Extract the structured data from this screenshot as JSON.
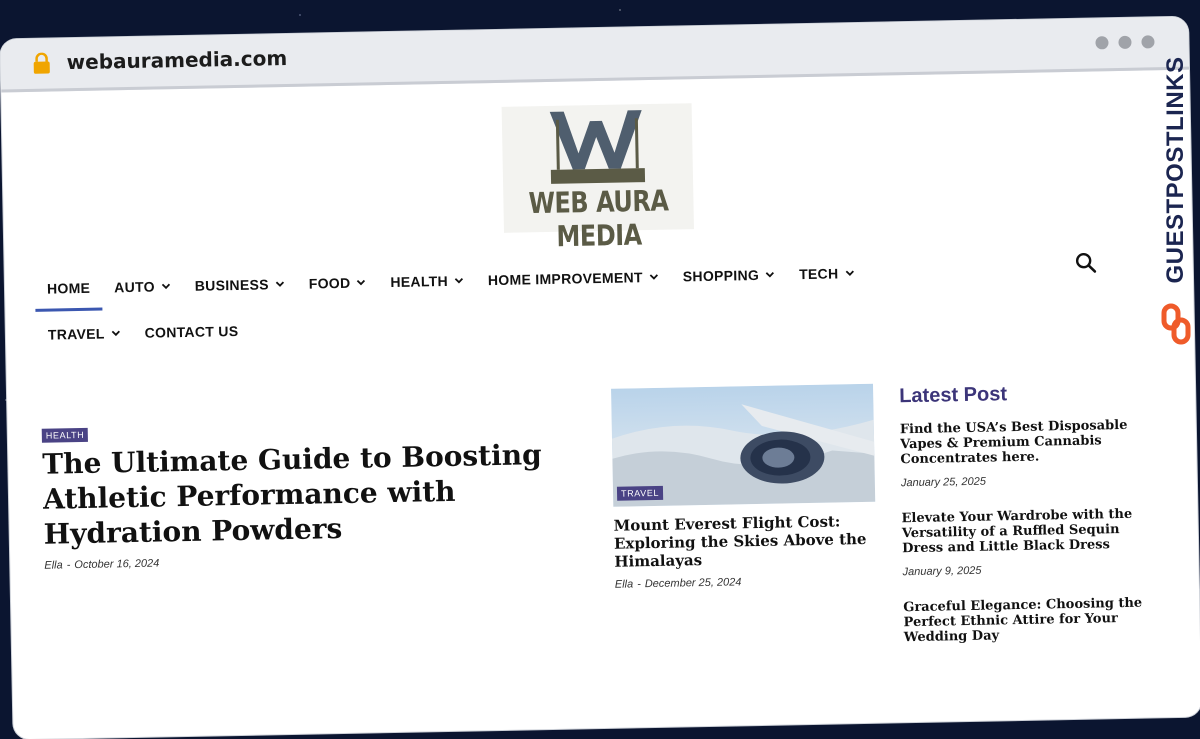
{
  "browser": {
    "url": "webauramedia.com",
    "lock_color": "#f0a500"
  },
  "site": {
    "logo_text": "WEB AURA MEDIA",
    "brand_colors": {
      "logo_blue": "#4f5e6e",
      "logo_olive": "#5b5b46",
      "accent": "#3b57b0"
    }
  },
  "nav": {
    "row1": [
      {
        "label": "HOME",
        "dropdown": false,
        "active": true
      },
      {
        "label": "AUTO",
        "dropdown": true
      },
      {
        "label": "BUSINESS",
        "dropdown": true
      },
      {
        "label": "FOOD",
        "dropdown": true
      },
      {
        "label": "HEALTH",
        "dropdown": true
      },
      {
        "label": "HOME IMPROVEMENT",
        "dropdown": true
      },
      {
        "label": "SHOPPING",
        "dropdown": true
      },
      {
        "label": "TECH",
        "dropdown": true
      }
    ],
    "row2": [
      {
        "label": "TRAVEL",
        "dropdown": true
      },
      {
        "label": "CONTACT US",
        "dropdown": false
      }
    ],
    "search_icon": "search-icon"
  },
  "hero": {
    "category": "HEALTH",
    "title": "The Ultimate Guide to Boosting Athletic Performance with Hydration Powders",
    "author": "Ella",
    "date": "October 16, 2024"
  },
  "card": {
    "category": "TRAVEL",
    "title": "Mount Everest Flight Cost: Exploring the Skies Above the Himalayas",
    "author": "Ella",
    "date": "December 25, 2024"
  },
  "sidebar": {
    "heading": "Latest Post",
    "posts": [
      {
        "title": "Find the USA’s Best Disposable Vapes & Premium Cannabis Concentrates here.",
        "date": "January 25, 2025"
      },
      {
        "title": "Elevate Your Wardrobe with the Versatility of a Ruffled Sequin Dress and Little Black Dress",
        "date": "January 9, 2025"
      },
      {
        "title": "Graceful Elegance: Choosing the Perfect Ethnic Attire for Your Wedding Day",
        "date": ""
      }
    ]
  },
  "watermark": {
    "text": "GUESTPOSTLINKS",
    "color": "#1b2550",
    "icon_color": "#ef5b2a"
  },
  "meta_sep": "-"
}
